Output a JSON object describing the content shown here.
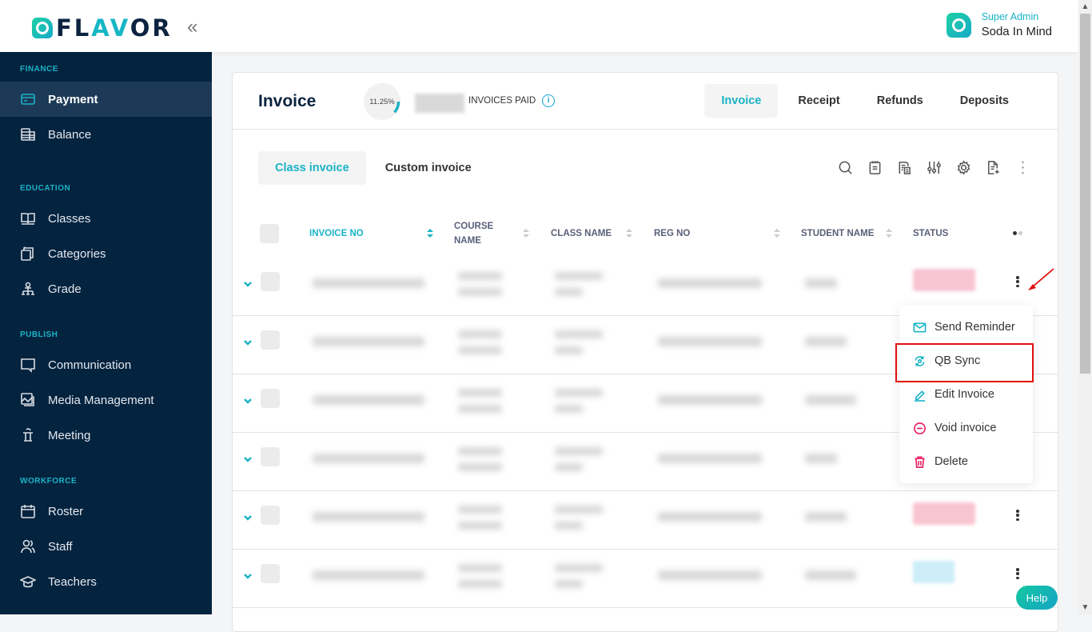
{
  "brand": {
    "name_pre": "FL",
    "name_accent": "AV",
    "name_post": "OR",
    "accent_color": "#19b3c6",
    "navy": "#04233f"
  },
  "topbar": {
    "collapse_icon": "«",
    "user_role": "Super Admin",
    "user_name": "Soda In Mind"
  },
  "sidebar": {
    "sections": [
      {
        "title": "FINANCE",
        "items": [
          {
            "label": "Payment",
            "icon": "credit-card-icon",
            "active": true
          },
          {
            "label": "Balance",
            "icon": "stack-icon"
          }
        ]
      },
      {
        "title": "EDUCATION",
        "items": [
          {
            "label": "Classes",
            "icon": "book-icon"
          },
          {
            "label": "Categories",
            "icon": "layers-icon"
          },
          {
            "label": "Grade",
            "icon": "hierarchy-icon"
          }
        ]
      },
      {
        "title": "PUBLISH",
        "items": [
          {
            "label": "Communication",
            "icon": "chat-icon"
          },
          {
            "label": "Media Management",
            "icon": "image-icon"
          },
          {
            "label": "Meeting",
            "icon": "podium-icon"
          }
        ]
      },
      {
        "title": "WORKFORCE",
        "items": [
          {
            "label": "Roster",
            "icon": "calendar-icon"
          },
          {
            "label": "Staff",
            "icon": "users-icon"
          },
          {
            "label": "Teachers",
            "icon": "graduation-cap-icon"
          }
        ]
      }
    ]
  },
  "header": {
    "title": "Invoice",
    "progress_label": "11.25%",
    "progress_value": 11.25,
    "paid_label": "INVOICES PAID",
    "info_icon": "i",
    "tabs": [
      {
        "label": "Invoice",
        "active": true
      },
      {
        "label": "Receipt"
      },
      {
        "label": "Refunds"
      },
      {
        "label": "Deposits"
      }
    ]
  },
  "subtabs": [
    {
      "label": "Class invoice",
      "active": true
    },
    {
      "label": "Custom invoice"
    }
  ],
  "toolbar": [
    "search-icon",
    "notepad-icon",
    "report-icon",
    "filter-sliders-icon",
    "gear-icon",
    "export-file-icon",
    "more-vertical-icon"
  ],
  "table": {
    "columns": [
      {
        "label": "INVOICE NO",
        "sortable": true,
        "active": true
      },
      {
        "label": "COURSE NAME",
        "sortable": true
      },
      {
        "label": "CLASS NAME",
        "sortable": true
      },
      {
        "label": "REG NO",
        "sortable": true
      },
      {
        "label": "STUDENT NAME",
        "sortable": true
      },
      {
        "label": "STATUS",
        "sortable": false
      }
    ],
    "rows": [
      {
        "status_color": "#f9c4d2",
        "has_status": true
      },
      {
        "status_color": "",
        "has_status": false
      },
      {
        "status_color": "",
        "has_status": false
      },
      {
        "status_color": "",
        "has_status": false
      },
      {
        "status_color": "#f9c4d2",
        "has_status": true
      },
      {
        "status_color": "#cdeef8",
        "has_status": true
      }
    ]
  },
  "row_menu": {
    "items": [
      {
        "label": "Send Reminder",
        "icon": "mail-icon",
        "color": "#19b3c6"
      },
      {
        "label": "QB Sync",
        "icon": "sync-icon",
        "color": "#19b3c6",
        "highlighted": true
      },
      {
        "label": "Edit Invoice",
        "icon": "pencil-icon",
        "color": "#19b3c6"
      },
      {
        "label": "Void invoice",
        "icon": "minus-circle-icon",
        "color": "#e8185f"
      },
      {
        "label": "Delete",
        "icon": "trash-icon",
        "color": "#e8185f"
      }
    ]
  },
  "help": {
    "label": "Help"
  }
}
